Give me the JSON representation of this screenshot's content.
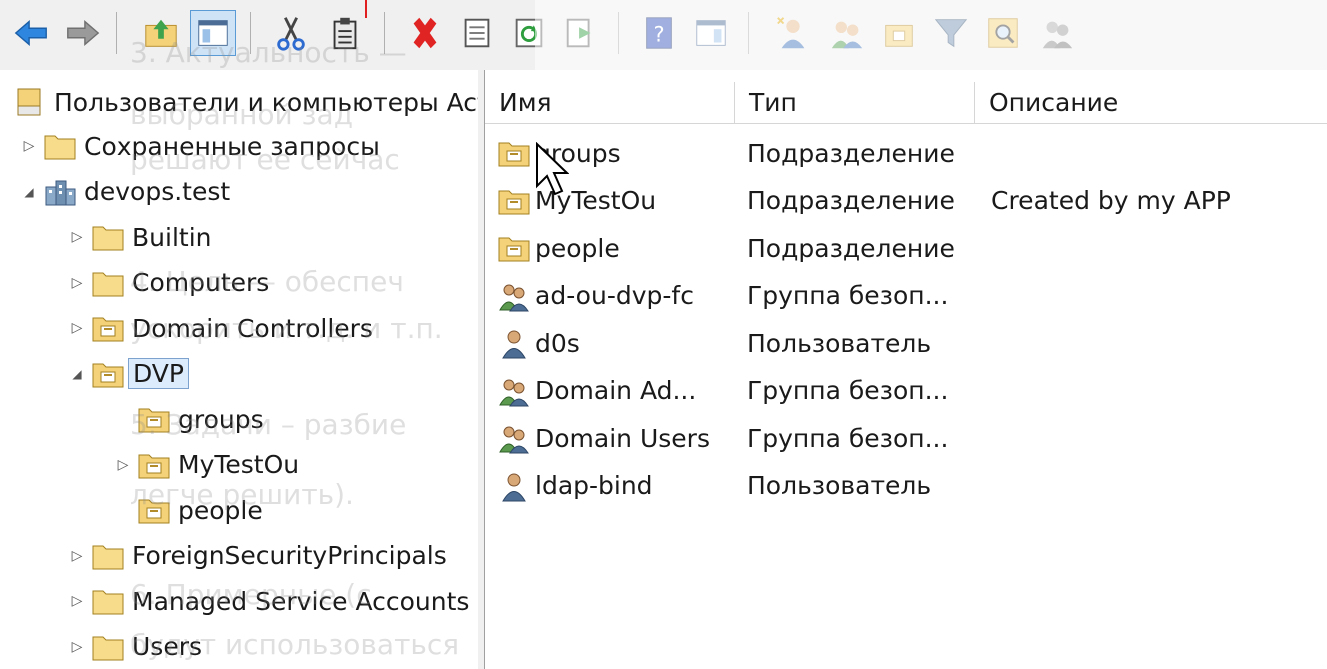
{
  "tree": {
    "root": "Пользователи и компьютеры Active Directory",
    "items": [
      {
        "label": "Сохраненные запросы",
        "expander": "collapsed"
      },
      {
        "label": "devops.test",
        "expander": "expanded"
      },
      {
        "label": "Builtin",
        "expander": "collapsed"
      },
      {
        "label": "Computers",
        "expander": "collapsed"
      },
      {
        "label": "Domain Controllers",
        "expander": "collapsed"
      },
      {
        "label": "DVP",
        "expander": "expanded",
        "selected": true
      },
      {
        "label": "groups",
        "expander": "none"
      },
      {
        "label": "MyTestOu",
        "expander": "collapsed"
      },
      {
        "label": "people",
        "expander": "none"
      },
      {
        "label": "ForeignSecurityPrincipals",
        "expander": "collapsed"
      },
      {
        "label": "Managed Service Accounts",
        "expander": "collapsed"
      },
      {
        "label": "Users",
        "expander": "collapsed"
      }
    ]
  },
  "list": {
    "columns": [
      "Имя",
      "Тип",
      "Описание"
    ],
    "rows": [
      {
        "name": "groups",
        "type": "Подразделение",
        "description": "",
        "icon": "ou-icon"
      },
      {
        "name": "MyTestOu",
        "type": "Подразделение",
        "description": "Created by my APP",
        "icon": "ou-icon"
      },
      {
        "name": "people",
        "type": "Подразделение",
        "description": "",
        "icon": "ou-icon"
      },
      {
        "name": "ad-ou-dvp-fc",
        "type": "Группа безоп...",
        "description": "",
        "icon": "group-icon"
      },
      {
        "name": "d0s",
        "type": "Пользователь",
        "description": "",
        "icon": "user-icon"
      },
      {
        "name": "Domain Ad...",
        "type": "Группа безоп...",
        "description": "",
        "icon": "group-icon"
      },
      {
        "name": "Domain Users",
        "type": "Группа безоп...",
        "description": "",
        "icon": "group-icon"
      },
      {
        "name": "ldap-bind",
        "type": "Пользователь",
        "description": "",
        "icon": "user-icon"
      }
    ]
  },
  "ghost_text": [
    "3. Актуальность —",
    "выбранной зад",
    "решают ее сейчас",
    "4. Цель — обеспеч",
    "ускорить и т.д. и т.п.",
    "5. Задачи – разбие",
    "легче решить).",
    "6. Примерные (с",
    "будут использоваться"
  ],
  "colors": {
    "accent": "#3c7fd6",
    "folder": "#f3d27a",
    "selection": "#dcecfc"
  }
}
